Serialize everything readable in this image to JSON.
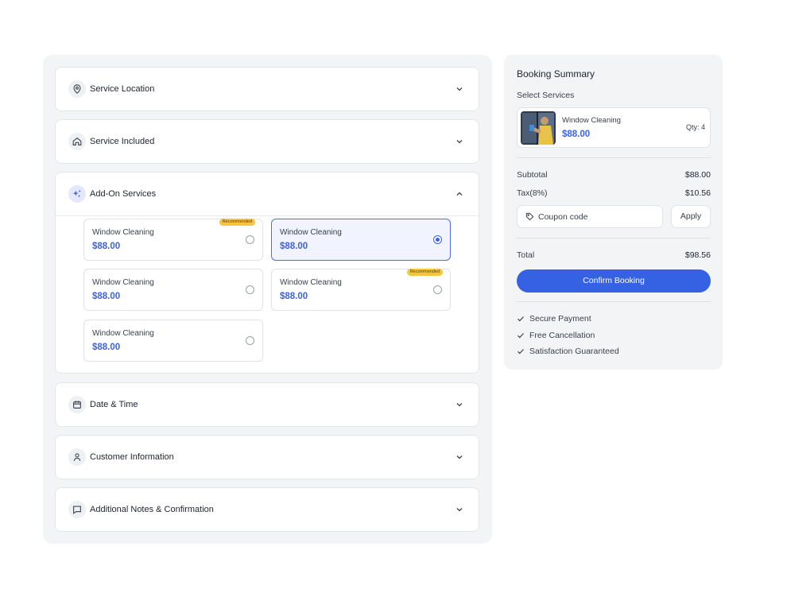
{
  "accordion": {
    "location": {
      "title": "Service Location",
      "icon": "location-pin-icon"
    },
    "included": {
      "title": "Service Included",
      "icon": "home-icon"
    },
    "addons": {
      "title": "Add-On Services",
      "icon": "sparkles-icon",
      "options": [
        {
          "name": "Window Cleaning",
          "price": "$88.00",
          "badge": "Recommended",
          "selected": false
        },
        {
          "name": "Window Cleaning",
          "price": "$88.00",
          "badge": "",
          "selected": true
        },
        {
          "name": "Window Cleaning",
          "price": "$88.00",
          "badge": "",
          "selected": false
        },
        {
          "name": "Window Cleaning",
          "price": "$88.00",
          "badge": "Recommended",
          "selected": false
        },
        {
          "name": "Window Cleaning",
          "price": "$88.00",
          "badge": "",
          "selected": false
        }
      ]
    },
    "datetime": {
      "title": "Date & Time",
      "icon": "calendar-icon"
    },
    "customer": {
      "title": "Customer Information",
      "icon": "user-icon"
    },
    "notes": {
      "title": "Additional Notes & Confirmation",
      "icon": "chat-bubble-icon"
    }
  },
  "summary": {
    "title": "Booking Summary",
    "subtitle": "Select Services",
    "service": {
      "name": "Window Cleaning",
      "price": "$88.00",
      "qty": "Qty: 4"
    },
    "subtotal_label": "Subtotal",
    "subtotal_value": "$88.00",
    "tax_label": "Tax(8%)",
    "tax_value": "$10.56",
    "coupon_placeholder": "Coupon code",
    "apply_label": "Apply",
    "total_label": "Total",
    "total_value": "$98.56",
    "confirm_label": "Confirm Booking",
    "features": [
      "Secure Payment",
      "Free Cancellation",
      "Satisfaction Guaranteed"
    ]
  },
  "colors": {
    "accent": "#3462e3",
    "price": "#3b63e2",
    "badge": "#f6c43d",
    "panel": "#f3f4f6"
  }
}
